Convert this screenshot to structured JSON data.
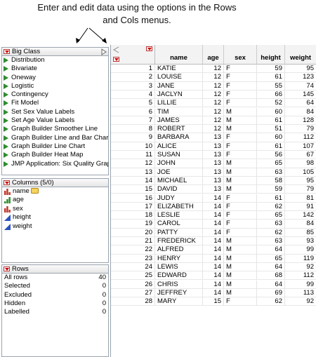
{
  "annotation": "Enter and edit data using the options in the Rows and Cols menus.",
  "tables_panel": {
    "title": "Big Class",
    "scripts": [
      "Distribution",
      "Bivariate",
      "Oneway",
      "Logistic",
      "Contingency",
      "Fit Model",
      "Set Sex Value Labels",
      "Set Age Value Labels",
      "Graph Builder Smoother Line",
      "Graph Builder Line and Bar Charts",
      "Graph Builder Line Chart",
      "Graph Builder Heat Map",
      "JMP Application: Six Quality Graphs"
    ]
  },
  "columns_panel": {
    "title": "Columns (5/0)",
    "items": [
      {
        "label": "name",
        "icon": "nominal-icon"
      },
      {
        "label": "age",
        "icon": "ordinal-icon"
      },
      {
        "label": "sex",
        "icon": "nominal-icon"
      },
      {
        "label": "height",
        "icon": "continuous-icon"
      },
      {
        "label": "weight",
        "icon": "continuous-icon"
      }
    ]
  },
  "rows_panel": {
    "title": "Rows",
    "items": [
      {
        "label": "All rows",
        "count": "40"
      },
      {
        "label": "Selected",
        "count": "0"
      },
      {
        "label": "Excluded",
        "count": "0"
      },
      {
        "label": "Hidden",
        "count": "0"
      },
      {
        "label": "Labelled",
        "count": "0"
      }
    ]
  },
  "colors": {
    "red_triangle": "#cc0000",
    "script_green": "#2e8b2e",
    "continuous_blue": "#2a52be"
  },
  "table": {
    "columns": [
      "name",
      "age",
      "sex",
      "height",
      "weight"
    ],
    "rows": [
      [
        "1",
        "KATIE",
        "12",
        "F",
        "59",
        "95"
      ],
      [
        "2",
        "LOUISE",
        "12",
        "F",
        "61",
        "123"
      ],
      [
        "3",
        "JANE",
        "12",
        "F",
        "55",
        "74"
      ],
      [
        "4",
        "JACLYN",
        "12",
        "F",
        "66",
        "145"
      ],
      [
        "5",
        "LILLIE",
        "12",
        "F",
        "52",
        "64"
      ],
      [
        "6",
        "TIM",
        "12",
        "M",
        "60",
        "84"
      ],
      [
        "7",
        "JAMES",
        "12",
        "M",
        "61",
        "128"
      ],
      [
        "8",
        "ROBERT",
        "12",
        "M",
        "51",
        "79"
      ],
      [
        "9",
        "BARBARA",
        "13",
        "F",
        "60",
        "112"
      ],
      [
        "10",
        "ALICE",
        "13",
        "F",
        "61",
        "107"
      ],
      [
        "11",
        "SUSAN",
        "13",
        "F",
        "56",
        "67"
      ],
      [
        "12",
        "JOHN",
        "13",
        "M",
        "65",
        "98"
      ],
      [
        "13",
        "JOE",
        "13",
        "M",
        "63",
        "105"
      ],
      [
        "14",
        "MICHAEL",
        "13",
        "M",
        "58",
        "95"
      ],
      [
        "15",
        "DAVID",
        "13",
        "M",
        "59",
        "79"
      ],
      [
        "16",
        "JUDY",
        "14",
        "F",
        "61",
        "81"
      ],
      [
        "17",
        "ELIZABETH",
        "14",
        "F",
        "62",
        "91"
      ],
      [
        "18",
        "LESLIE",
        "14",
        "F",
        "65",
        "142"
      ],
      [
        "19",
        "CAROL",
        "14",
        "F",
        "63",
        "84"
      ],
      [
        "20",
        "PATTY",
        "14",
        "F",
        "62",
        "85"
      ],
      [
        "21",
        "FREDERICK",
        "14",
        "M",
        "63",
        "93"
      ],
      [
        "22",
        "ALFRED",
        "14",
        "M",
        "64",
        "99"
      ],
      [
        "23",
        "HENRY",
        "14",
        "M",
        "65",
        "119"
      ],
      [
        "24",
        "LEWIS",
        "14",
        "M",
        "64",
        "92"
      ],
      [
        "25",
        "EDWARD",
        "14",
        "M",
        "68",
        "112"
      ],
      [
        "26",
        "CHRIS",
        "14",
        "M",
        "64",
        "99"
      ],
      [
        "27",
        "JEFFREY",
        "14",
        "M",
        "69",
        "113"
      ],
      [
        "28",
        "MARY",
        "15",
        "F",
        "62",
        "92"
      ]
    ]
  }
}
